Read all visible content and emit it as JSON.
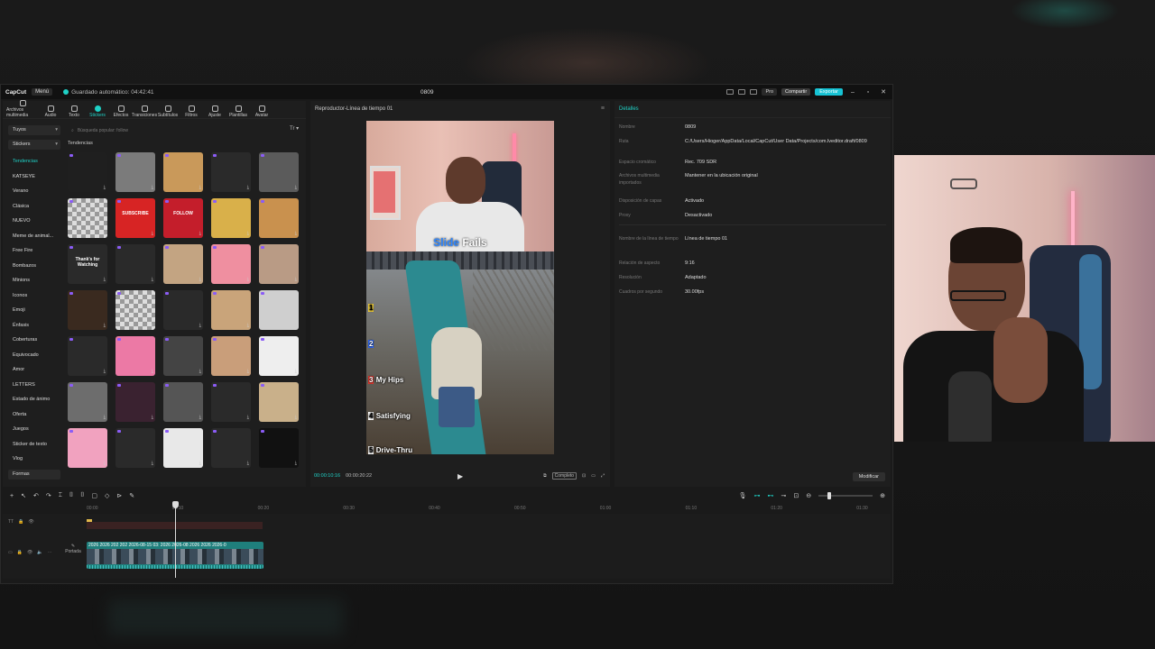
{
  "app": {
    "logo": "CapCut",
    "menu": "Menú",
    "autosave": "Guardado automático: 04:42:41",
    "project_title": "0809",
    "pro": "Pro",
    "share": "Compartir",
    "export": "Exportar"
  },
  "toolbar": [
    "Archivos multimedia",
    "Audio",
    "Texto",
    "Stickers",
    "Efectos",
    "Transiciones",
    "Subtítulos",
    "Filtros",
    "Ajuste",
    "Plantillas",
    "Avatar"
  ],
  "categories": {
    "tuyos": "Tuyos",
    "stickers": "Stickers",
    "items": [
      "Tendencias",
      "KATSEYE",
      "Verano",
      "Clásica",
      "NUEVO",
      "Meme de animal...",
      "Free Fire",
      "Bombazos",
      "Minions",
      "Iconos",
      "Emoji",
      "Énfasis",
      "Coberturas",
      "Equivocado",
      "Amor",
      "LETTERS",
      "Estado de ánimo",
      "Oferta",
      "Juegos",
      "Sticker de texto",
      "Vlog"
    ],
    "last": "Formas"
  },
  "search": {
    "placeholder": "Búsqueda popular: follow"
  },
  "trend_heading": "Tendencias",
  "stickers": [
    {
      "color": "#1f1f1f",
      "text": ""
    },
    {
      "color": "#7b7b7b",
      "text": ""
    },
    {
      "color": "#c9995a",
      "text": ""
    },
    {
      "color": "#2a2a2a",
      "text": ""
    },
    {
      "color": "#5b5b5b",
      "text": ""
    },
    {
      "color": "#9a9a9a",
      "text": ""
    },
    {
      "color": "#d72424",
      "text": "SUBSCRIBE"
    },
    {
      "color": "#c41e2b",
      "text": "FOLLOW"
    },
    {
      "color": "#d9b04a",
      "text": ""
    },
    {
      "color": "#c9914e",
      "text": ""
    },
    {
      "color": "#2a2a2a",
      "text": "Thank's for Watching"
    },
    {
      "color": "#2a2a2a",
      "text": ""
    },
    {
      "color": "#c3a482",
      "text": ""
    },
    {
      "color": "#ef8fa0",
      "text": ""
    },
    {
      "color": "#b99b85",
      "text": ""
    },
    {
      "color": "#3a2a1f",
      "text": ""
    },
    {
      "color": "#9a9a9a",
      "text": ""
    },
    {
      "color": "#2a2a2a",
      "text": ""
    },
    {
      "color": "#c9a47a",
      "text": ""
    },
    {
      "color": "#cfcfcf",
      "text": ""
    },
    {
      "color": "#2a2a2a",
      "text": ""
    },
    {
      "color": "#ec79a5",
      "text": ""
    },
    {
      "color": "#444",
      "text": ""
    },
    {
      "color": "#c99e7a",
      "text": ""
    },
    {
      "color": "#eee",
      "text": ""
    },
    {
      "color": "#6d6d6d",
      "text": ""
    },
    {
      "color": "#3a2230",
      "text": ""
    },
    {
      "color": "#555",
      "text": ""
    },
    {
      "color": "#2a2a2a",
      "text": ""
    },
    {
      "color": "#c9b08a",
      "text": ""
    },
    {
      "color": "#f1a2bf",
      "text": ""
    },
    {
      "color": "#2a2a2a",
      "text": ""
    },
    {
      "color": "#e8e8e8",
      "text": ""
    },
    {
      "color": "#2a2a2a",
      "text": ""
    },
    {
      "color": "#111",
      "text": ""
    }
  ],
  "player": {
    "header": "Reproductor-Línea de tiempo 01",
    "title_a": "Slide",
    "title_b": "Fails",
    "labels": [
      {
        "n": "1",
        "text": ""
      },
      {
        "n": "2",
        "text": ""
      },
      {
        "n": "3",
        "text": "My Hips"
      },
      {
        "n": "4",
        "text": "Satisfying"
      },
      {
        "n": "5",
        "text": "Drive-Thru"
      }
    ],
    "time_current": "00:00:10:16",
    "time_total": "00:00:20:22",
    "complete": "Completo"
  },
  "details": {
    "header": "Detalles",
    "rows": [
      {
        "label": "Nombre",
        "value": "0809"
      },
      {
        "label": "Ruta",
        "value": "C:/Users/Hioger/AppData/Local/CapCut/User Data/Projects/com.lveditor.draft/0809"
      },
      {
        "label": "Espacio cromático",
        "value": "Rec. 709 SDR"
      },
      {
        "label": "Archivos multimedia importados",
        "value": "Mantener en la ubicación original"
      },
      {
        "label": "Disposición de capas",
        "value": "Activado"
      },
      {
        "label": "Proxy",
        "value": "Desactivado"
      },
      {
        "label": "Nombre de la línea de tiempo",
        "value": "Línea de tiempo 01"
      },
      {
        "label": "Relación de aspecto",
        "value": "9:16"
      },
      {
        "label": "Resolución",
        "value": "Adaptado"
      },
      {
        "label": "Cuadros por segundo",
        "value": "30.00fps"
      }
    ],
    "modify": "Modificar"
  },
  "timeline": {
    "ticks": [
      "00:00",
      "00:10",
      "00:20",
      "00:30",
      "00:40",
      "00:50",
      "01:00",
      "01:10",
      "01:20",
      "01:30"
    ],
    "portada": "Portada",
    "clip_label": "2026  2026  202  202  2026-08-15 03:  2026  2026-08  2026  2026  2026-0"
  }
}
